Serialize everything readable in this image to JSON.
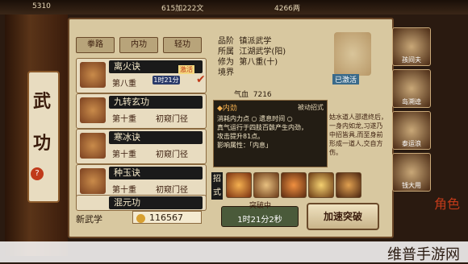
{
  "topbar": {
    "left": "5310",
    "mid": "615加222文",
    "right": "4266两"
  },
  "scroll": {
    "chars": [
      "武",
      "功"
    ],
    "badge": "?"
  },
  "tabs": [
    "拳路",
    "内功",
    "轻功"
  ],
  "skills": [
    {
      "name": "离火诀",
      "level": "第八重",
      "status": "",
      "timer": "1时21分",
      "tag": "激活",
      "checked": true
    },
    {
      "name": "九转玄功",
      "level": "第十重",
      "status": "初窥门径"
    },
    {
      "name": "寒冰诀",
      "level": "第十重",
      "status": "初窥门径"
    },
    {
      "name": "种玉诀",
      "level": "第十重",
      "status": "初窥门径"
    },
    {
      "name": "混元功",
      "level": "",
      "status": ""
    }
  ],
  "info": {
    "grade_label": "品阶",
    "grade": "镇派武学",
    "belong_label": "所属",
    "belong": "江湖武学(阳)",
    "cultivation_label": "修为",
    "cultivation": "第八重(十)",
    "realm_label": "境界"
  },
  "avatar_tag": "已激活",
  "stats": {
    "qi_label": "气血",
    "qi": "7216"
  },
  "tooltip": {
    "title": "◆内劲",
    "sub": "被动招式",
    "lines": [
      "消耗内力点 ○  遗息时间 ○",
      "真气运行于四肢百骸产生内劲，",
      "攻击提升81点。",
      "影响属性：「内息」"
    ]
  },
  "lore": "姑水道人邵遗终后，一身内如龙,习遂乃中招皆具,而至身前形成一道人,交自方伤。",
  "moves_label": "招式",
  "breakthrough": {
    "label": "突破中",
    "time": "1时21分2秒"
  },
  "accel": "加速突破",
  "newskill": "新武学",
  "coins": "116567",
  "portraits": [
    "孩间夫",
    "岛溯逵",
    "泰运浪",
    "钱大用"
  ],
  "side_deco": "角色",
  "watermark": "维普手游网"
}
